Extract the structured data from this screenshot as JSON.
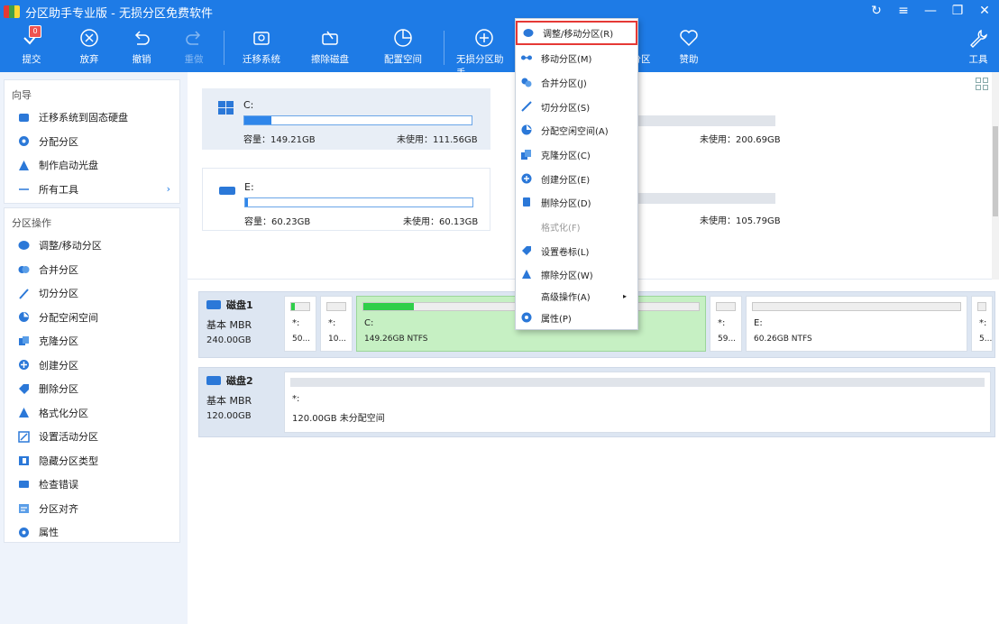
{
  "window": {
    "title": "分区助手专业版 - 无损分区免费软件",
    "controls": [
      "↻",
      "≡",
      "—",
      "❐",
      "✕"
    ]
  },
  "toolbar": {
    "buttons": [
      {
        "label": "提交",
        "icon": "check-icon",
        "badge": "0"
      },
      {
        "label": "放弃",
        "icon": "x-circle-icon"
      },
      {
        "label": "撤销",
        "icon": "undo-icon"
      },
      {
        "label": "重做",
        "icon": "redo-icon"
      },
      {
        "label": "迁移系统",
        "icon": "migrate-icon"
      },
      {
        "label": "擦除磁盘",
        "icon": "wipe-disk-icon"
      },
      {
        "label": "配置空间",
        "icon": "allocate-space-icon"
      },
      {
        "label": "无损分区助手",
        "icon": "plus-circle-icon"
      },
      {
        "label": "分区",
        "icon": "partition-icon"
      },
      {
        "label": "赞助",
        "icon": "heart-icon"
      },
      {
        "label": "工具",
        "icon": "wrench-icon"
      }
    ]
  },
  "sidebar": {
    "wizard": {
      "title": "向导",
      "items": [
        {
          "label": "迁移系统到固态硬盘",
          "icon": "ssd-migrate-icon"
        },
        {
          "label": "分配分区",
          "icon": "allocate-partition-icon"
        },
        {
          "label": "制作启动光盘",
          "icon": "bootable-disc-icon"
        },
        {
          "label": "所有工具",
          "icon": "all-tools-icon",
          "chevron": "›"
        }
      ]
    },
    "operations": {
      "title": "分区操作",
      "items": [
        {
          "label": "调整/移动分区",
          "icon": "resize-partition-icon"
        },
        {
          "label": "合并分区",
          "icon": "merge-partition-icon"
        },
        {
          "label": "切分分区",
          "icon": "split-partition-icon"
        },
        {
          "label": "分配空闲空间",
          "icon": "allocate-free-space-icon"
        },
        {
          "label": "克隆分区",
          "icon": "clone-partition-icon"
        },
        {
          "label": "创建分区",
          "icon": "create-partition-icon"
        },
        {
          "label": "删除分区",
          "icon": "delete-partition-icon"
        },
        {
          "label": "格式化分区",
          "icon": "format-partition-icon"
        },
        {
          "label": "设置活动分区",
          "icon": "set-active-icon"
        },
        {
          "label": "隐藏分区类型",
          "icon": "hide-partition-icon"
        },
        {
          "label": "检查错误",
          "icon": "check-error-icon"
        },
        {
          "label": "分区对齐",
          "icon": "align-partition-icon"
        },
        {
          "label": "属性",
          "icon": "properties-icon"
        }
      ]
    }
  },
  "cards": [
    {
      "name": "C:",
      "capacity": "容量：149.21GB",
      "free": "未使用：111.56GB",
      "usage": 0.12
    },
    {
      "name": "E:",
      "capacity": "容量：60.23GB",
      "free": "未使用：60.13GB",
      "usage": 0.01
    },
    {
      "name": "",
      "capacity": "",
      "free": "未使用：200.69GB",
      "usage": 0
    },
    {
      "name": "",
      "capacity": "",
      "free": "未使用：105.79GB",
      "usage": 0
    }
  ],
  "disks": [
    {
      "title": "磁盘1",
      "type": "基本 MBR",
      "size": "240.00GB",
      "partitions": [
        {
          "label": "*:",
          "size": "50...",
          "usage": 0.2
        },
        {
          "label": "*:",
          "size": "10...",
          "usage": 0
        },
        {
          "label": "C:",
          "size": "149.26GB NTFS",
          "usage": 0.15,
          "selected": true
        },
        {
          "label": "*:",
          "size": "59...",
          "usage": 0
        },
        {
          "label": "E:",
          "size": "60.26GB NTFS",
          "usage": 0
        },
        {
          "label": "*:",
          "size": "5...",
          "usage": 0
        }
      ]
    },
    {
      "title": "磁盘2",
      "type": "基本 MBR",
      "size": "120.00GB",
      "partitions": [
        {
          "label": "*:",
          "size": "120.00GB 未分配空间",
          "usage": 0
        }
      ]
    }
  ],
  "context_menu": {
    "items": [
      {
        "label": "调整/移动分区(R)",
        "icon": "resize-icon",
        "highlighted": true
      },
      {
        "label": "移动分区(M)",
        "icon": "move-icon"
      },
      {
        "label": "合并分区(J)",
        "icon": "merge-icon"
      },
      {
        "label": "切分分区(S)",
        "icon": "split-icon"
      },
      {
        "label": "分配空闲空间(A)",
        "icon": "allocate-icon"
      },
      {
        "label": "克隆分区(C)",
        "icon": "clone-icon"
      },
      {
        "label": "创建分区(E)",
        "icon": "create-icon"
      },
      {
        "label": "删除分区(D)",
        "icon": "delete-icon"
      },
      {
        "label": "格式化(F)",
        "icon": "format-icon",
        "disabled": true
      },
      {
        "label": "设置卷标(L)",
        "icon": "label-icon"
      },
      {
        "label": "擦除分区(W)",
        "icon": "wipe-icon"
      },
      {
        "label": "高级操作(A)",
        "icon": "advanced-icon",
        "submenu": "▸"
      },
      {
        "label": "属性(P)",
        "icon": "properties-icon"
      }
    ]
  }
}
